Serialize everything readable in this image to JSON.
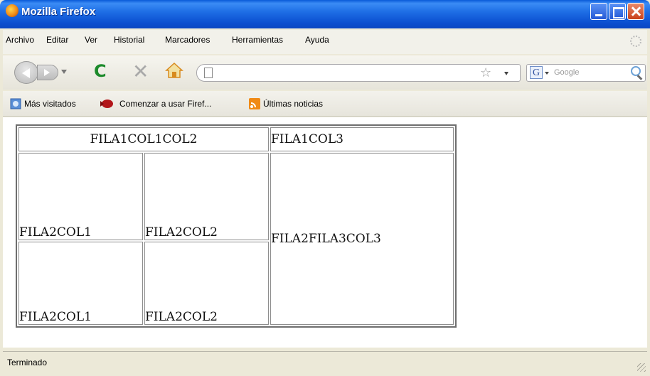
{
  "window": {
    "title": "Mozilla Firefox"
  },
  "menu": [
    "Archivo",
    "Editar",
    "Ver",
    "Historial",
    "Marcadores",
    "Herramientas",
    "Ayuda"
  ],
  "search": {
    "placeholder": "Google"
  },
  "bookmarks": [
    "Más visitados",
    "Comenzar a usar Firef...",
    "Últimas noticias"
  ],
  "table": {
    "row1": {
      "merged": "FILA1COL1COL2",
      "col3": "FILA1COL3"
    },
    "row2": {
      "col1": "FILA2COL1",
      "col2": "FILA2COL2",
      "merged_col3": "FILA2FILA3COL3"
    },
    "row3": {
      "col1": "FILA2COL1",
      "col2": "FILA2COL2"
    }
  },
  "status": "Terminado",
  "colors": {
    "titlebar": "#0b4fd0",
    "reload": "#1c8a2b",
    "close": "#c9411b"
  }
}
